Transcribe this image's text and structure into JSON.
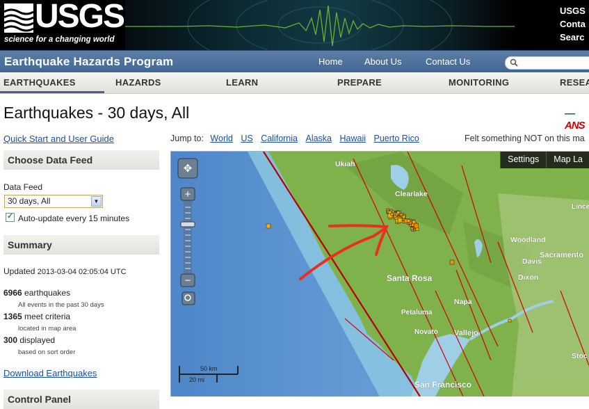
{
  "banner": {
    "logo_text": "USGS",
    "tagline": "science for a changing world",
    "quick_links": [
      "USGS",
      "Conta",
      "Searc"
    ]
  },
  "program": {
    "title": "Earthquake Hazards Program",
    "nav": [
      "Home",
      "About Us",
      "Contact Us"
    ]
  },
  "tabs": [
    "EARTHQUAKES",
    "HAZARDS",
    "LEARN",
    "PREPARE",
    "MONITORING",
    "RESEA"
  ],
  "page": {
    "title": "Earthquakes - 30 days, All",
    "badge": "ANS"
  },
  "sidebar": {
    "guide_link": "Quick Start and User Guide",
    "choose_feed_title": "Choose Data Feed",
    "feed_label": "Data Feed",
    "feed_selected": "30 days, All",
    "auto_update_label": "Auto-update every 15 minutes",
    "auto_update_checked": true,
    "summary_title": "Summary",
    "updated_label": "Updated",
    "updated_time": "2013-03-04 02:05:04 UTC",
    "stats": [
      {
        "count": "6966",
        "label": "earthquakes",
        "sub": "All events in the past 30 days"
      },
      {
        "count": "1365",
        "label": "meet criteria",
        "sub": "located in map area"
      },
      {
        "count": "300",
        "label": "displayed",
        "sub": "based on sort order"
      }
    ],
    "download_link": "Download Earthquakes",
    "control_panel_title": "Control Panel"
  },
  "jump": {
    "label": "Jump to:",
    "links": [
      "World",
      "US",
      "California",
      "Alaska",
      "Hawaii",
      "Puerto Rico"
    ],
    "felt_text": "Felt something NOT on this ma"
  },
  "map": {
    "buttons": [
      "Settings",
      "Map La"
    ],
    "places": [
      "Ukiah",
      "Clearlake",
      "Lince",
      "Woodland",
      "Davis",
      "Sacramento",
      "Dixon",
      "Santa Rosa",
      "Napa",
      "Petaluma",
      "Novato",
      "Vallejo",
      "San Francisco",
      "Stoc"
    ],
    "scale_km": "50 km",
    "scale_mi": "20 mi",
    "colors": {
      "ocean": "#6a9bd4",
      "land": "#7fb24a",
      "fault": "#d10000",
      "quake": "#f2b400"
    }
  }
}
